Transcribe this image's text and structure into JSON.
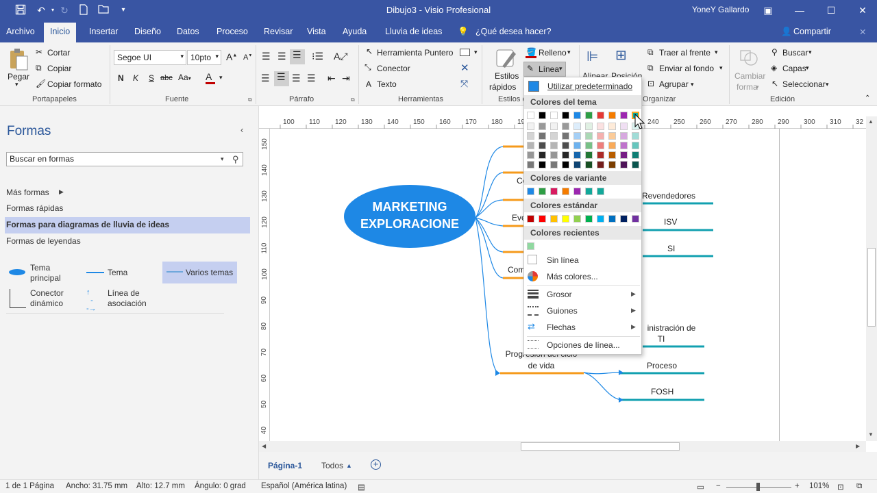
{
  "title_bar": {
    "document_title": "Dibujo3  -  Visio Profesional",
    "user": "YoneY Gallardo",
    "icons": [
      "save-icon",
      "undo-icon",
      "redo-icon",
      "new-icon",
      "open-icon",
      "customize-icon"
    ]
  },
  "tabs": [
    "Archivo",
    "Inicio",
    "Insertar",
    "Diseño",
    "Datos",
    "Proceso",
    "Revisar",
    "Vista",
    "Ayuda",
    "Lluvia de ideas"
  ],
  "tell_me": "¿Qué desea hacer?",
  "share": "Compartir",
  "ribbon": {
    "clipboard": {
      "paste": "Pegar",
      "cut": "Cortar",
      "copy": "Copiar",
      "format_painter": "Copiar formato",
      "group": "Portapapeles"
    },
    "font": {
      "family": "Segoe UI",
      "size": "10pto",
      "group": "Fuente",
      "bold": "N",
      "italic": "K",
      "underline": "S",
      "strike": "abc"
    },
    "paragraph": {
      "group": "Párrafo"
    },
    "tools": {
      "pointer": "Herramienta Puntero",
      "connector": "Conector",
      "text": "Texto",
      "group": "Herramientas"
    },
    "shape_styles": {
      "quick_styles_1": "Estilos",
      "quick_styles_2": "rápidos",
      "fill": "Relleno",
      "line": "Línea",
      "group": "Estilos de forma"
    },
    "arrange": {
      "align_1": "Alinear",
      "position_1": "Posición",
      "bring_front": "Traer al frente",
      "send_back": "Enviar al fondo",
      "group_btn": "Agrupar",
      "group": "Organizar"
    },
    "editing": {
      "change_shape_1": "Cambiar",
      "change_shape_2": "forma",
      "find": "Buscar",
      "layers": "Capas",
      "select": "Seleccionar",
      "group": "Edición"
    }
  },
  "left_pane": {
    "title": "Formas",
    "search_placeholder": "Buscar en formas",
    "more_shapes": "Más formas",
    "quick_shapes": "Formas rápidas",
    "brainstorm_shapes": "Formas para diagramas de lluvia de ideas",
    "callout_shapes": "Formas de leyendas",
    "stencils": [
      {
        "label_1": "Tema",
        "label_2": "principal"
      },
      {
        "label_1": "Tema",
        "label_2": ""
      },
      {
        "label_1": "Varios temas",
        "label_2": ""
      },
      {
        "label_1": "Conector",
        "label_2": "dinámico"
      },
      {
        "label_1": "Línea de",
        "label_2": "asociación"
      }
    ]
  },
  "ruler_top": [
    "100",
    "110",
    "120",
    "130",
    "140",
    "150",
    "160",
    "170",
    "180",
    "19",
    "240",
    "250",
    "260",
    "270",
    "280",
    "290",
    "300",
    "310",
    "32"
  ],
  "ruler_left": [
    "150",
    "140",
    "130",
    "120",
    "110",
    "100",
    "90",
    "80",
    "70",
    "60",
    "50",
    "40"
  ],
  "diagram": {
    "main_topic_1": "MARKETING",
    "main_topic_2": "EXPLORACIONE",
    "left_labels": [
      "Co",
      "Eve",
      "Com"
    ],
    "right_labels": [
      "Revendedores",
      "ISV",
      "SI"
    ],
    "admin_1": "inistración de",
    "admin_2": "TI",
    "lifecycle_1": "Progresión del ciclo",
    "lifecycle_2": "de vida",
    "process": "Proceso",
    "fosh": "FOSH"
  },
  "dropdown": {
    "default": "Utilizar predeterminado",
    "theme_colors": "Colores del tema",
    "variant_colors": "Colores de variante",
    "standard_colors": "Colores estándar",
    "recent_colors": "Colores recientes",
    "no_line": "Sin línea",
    "more_colors": "Más colores...",
    "weight": "Grosor",
    "dashes": "Guiones",
    "arrows": "Flechas",
    "line_options": "Opciones de línea...",
    "theme_top": [
      "#ffffff",
      "#000000",
      "#ffffff",
      "#000000",
      "#1e88e5",
      "#2e9e45",
      "#e53935",
      "#f57c00",
      "#9c27b0",
      "#12a89a"
    ],
    "variant": [
      "#1e88e5",
      "#2e9e45",
      "#d81b60",
      "#f57c00",
      "#9c27b0",
      "#12a89a",
      "#12a89a"
    ],
    "standard": [
      "#c00000",
      "#ff0000",
      "#ffc000",
      "#ffff00",
      "#92d050",
      "#00b050",
      "#00b0f0",
      "#0070c0",
      "#002060",
      "#7030a0"
    ],
    "recent": [
      "#90d9a0"
    ]
  },
  "page_tabs": {
    "page": "Página-1",
    "all": "Todos"
  },
  "status": {
    "page_count": "1 de 1 Página",
    "width": "Ancho: 31.75 mm",
    "height": "Alto: 12.7 mm",
    "angle": "Ángulo: 0 grad",
    "language": "Español (América latina)",
    "zoom": "101%"
  }
}
